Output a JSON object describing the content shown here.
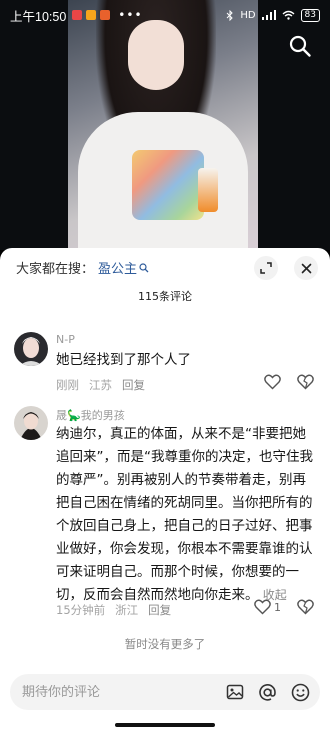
{
  "status_bar": {
    "time": "上午10:50",
    "more": "•••",
    "network": "HD",
    "battery": "83"
  },
  "header": {
    "search_prefix": "大家都在搜：",
    "search_keyword": "盈公主",
    "comment_count": "115条评论"
  },
  "comments": [
    {
      "user": "N-P",
      "text": "她已经找到了那个人了",
      "time": "刚刚",
      "location": "江苏",
      "reply_label": "回复"
    },
    {
      "user": "晟🦕我的男孩",
      "text_lines": [
        "纳迪尔，真正的体面，从来不是“非要把她",
        "追回来”，而是“我尊重你的决定，也守住我",
        "的尊严”。别再被别人的节奏带着走，别再",
        "把自己困在情绪的死胡同里。当你把所有的",
        "个放回自己身上，把自己的日子过好、把事",
        "业做好，你会发现，你根本不需要靠谁的认",
        "可来证明自己。而那个时候，你想要的一",
        "切，反而会自然而然地向你走来。"
      ],
      "collapse_label": "收起",
      "time": "15分钟前",
      "location": "浙江",
      "reply_label": "回复",
      "like_count": "1"
    }
  ],
  "no_more_text": "暂时没有更多了",
  "input": {
    "placeholder": "期待你的评论"
  }
}
